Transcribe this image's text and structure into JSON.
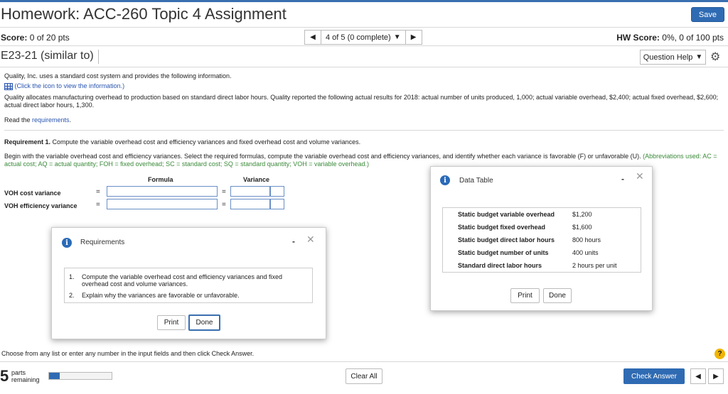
{
  "header": {
    "title": "Homework: ACC-260 Topic 4 Assignment",
    "save_label": "Save",
    "score_label": "Score:",
    "score_value": "0 of 20 pts",
    "question_nav": {
      "prev": "◀",
      "position": "4 of 5 (0 complete)",
      "caret": "▼",
      "next": "▶"
    },
    "hw_score_label": "HW Score:",
    "hw_score_value": "0%, 0 of 100 pts",
    "question_id": "E23-21 (similar to)",
    "question_help_label": "Question Help",
    "question_help_caret": "▼"
  },
  "problem": {
    "intro": "Quality, Inc. uses a standard cost system and provides the following information.",
    "click_icon": "(Click the icon to view the information.)",
    "body": "Quality allocates manufacturing overhead to production based on standard direct labor hours. Quality reported the following actual results for 2018: actual number of units produced, 1,000; actual variable overhead, $2,400; actual fixed overhead, $2,600; actual direct labor hours, 1,300.",
    "read_prefix": "Read the ",
    "read_link": "requirements",
    "read_suffix": ".",
    "req1_label": "Requirement 1.",
    "req1_text": " Compute the variable overhead cost and efficiency variances and fixed overhead cost and volume variances.",
    "begin_text": "Begin with the variable overhead cost and efficiency variances. Select the required formulas, compute the variable overhead cost and efficiency variances, and identify whether each variance is favorable (F) or unfavorable (U).",
    "abbrev_text": " (Abbreviations used: AC = actual cost; AQ = actual quantity; FOH = fixed overhead; SC = standard cost; SQ = standard quantity; VOH = variable overhead.)"
  },
  "form": {
    "formula_header": "Formula",
    "variance_header": "Variance",
    "rows": [
      {
        "label": "VOH cost variance",
        "eq1": "=",
        "eq2": "="
      },
      {
        "label": "VOH efficiency variance",
        "eq1": "=",
        "eq2": "="
      }
    ]
  },
  "requirements_dialog": {
    "title": "Requirements",
    "minimize": "-",
    "close": "✕",
    "items": [
      {
        "num": "1.",
        "text": "Compute the variable overhead cost and efficiency variances and fixed overhead cost and volume variances."
      },
      {
        "num": "2.",
        "text": "Explain why the variances are favorable or unfavorable."
      }
    ],
    "print_label": "Print",
    "done_label": "Done"
  },
  "data_table_dialog": {
    "title": "Data Table",
    "minimize": "-",
    "close": "✕",
    "rows": [
      {
        "label": "Static budget variable overhead",
        "value": "$1,200"
      },
      {
        "label": "Static budget fixed overhead",
        "value": "$1,600"
      },
      {
        "label": "Static budget direct labor hours",
        "value": "800 hours"
      },
      {
        "label": "Static budget number of units",
        "value": "400 units"
      },
      {
        "label": "Standard direct labor hours",
        "value": "2 hours per unit"
      }
    ],
    "print_label": "Print",
    "done_label": "Done"
  },
  "footer": {
    "instruction": "Choose from any list or enter any number in the input fields and then click Check Answer.",
    "help": "?",
    "parts_number": "5",
    "parts_label_1": "parts",
    "parts_label_2": "remaining",
    "progress_fraction": 0.17,
    "clear_all_label": "Clear All",
    "check_answer_label": "Check Answer",
    "prev": "◀",
    "next": "▶"
  },
  "colors": {
    "accent": "#2f6bb3",
    "link": "#2a55b0",
    "abbrev_green": "#3a8a3a",
    "help_yellow": "#f0b400"
  },
  "icons": [
    "table-icon",
    "info-icon",
    "gear-icon",
    "question-icon"
  ]
}
